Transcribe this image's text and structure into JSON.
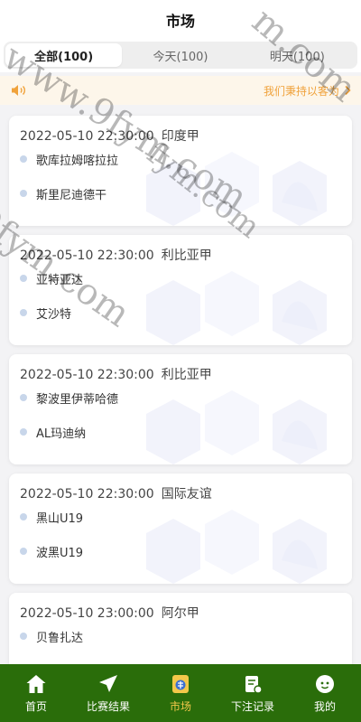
{
  "header": {
    "title": "市场"
  },
  "tabs": [
    {
      "label": "全部(100)",
      "active": true
    },
    {
      "label": "今天(100)",
      "active": false
    },
    {
      "label": "明天(100)",
      "active": false
    }
  ],
  "notice": {
    "text": "我们秉持以客为",
    "icon": "speaker-icon",
    "accent": "#f0a23b"
  },
  "matches": [
    {
      "datetime": "2022-05-10 22:30:00",
      "league": "印度甲",
      "home": "歌库拉姆喀拉拉",
      "away": "斯里尼迪德干"
    },
    {
      "datetime": "2022-05-10 22:30:00",
      "league": "利比亚甲",
      "home": "亚特亚达",
      "away": "艾沙特"
    },
    {
      "datetime": "2022-05-10 22:30:00",
      "league": "利比亚甲",
      "home": "黎波里伊蒂哈德",
      "away": "AL玛迪纳"
    },
    {
      "datetime": "2022-05-10 22:30:00",
      "league": "国际友谊",
      "home": "黑山U19",
      "away": "波黑U19"
    },
    {
      "datetime": "2022-05-10 23:00:00",
      "league": "阿尔甲",
      "home": "贝鲁扎达",
      "away": ""
    }
  ],
  "watermarks": [
    "www.9fym.com",
    "9fym.com",
    "m.com",
    "fym.com"
  ],
  "tabbar": {
    "items": [
      {
        "label": "首页",
        "icon": "home-icon"
      },
      {
        "label": "比赛结果",
        "icon": "send-icon"
      },
      {
        "label": "市场",
        "icon": "market-icon",
        "active": true
      },
      {
        "label": "下注记录",
        "icon": "bet-record-icon"
      },
      {
        "label": "我的",
        "icon": "profile-icon"
      }
    ],
    "bg": "#2a6d0a",
    "active_color": "#f3c84a"
  }
}
